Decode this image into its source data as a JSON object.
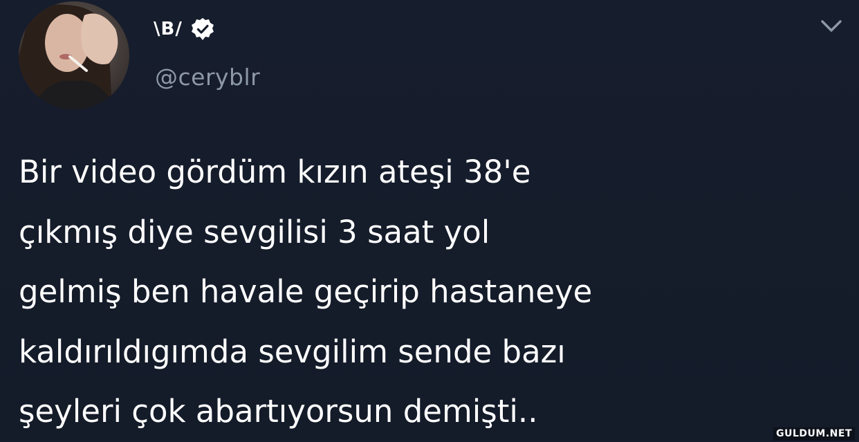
{
  "tweet": {
    "display_name": "\\B/",
    "handle": "@ceryblr",
    "verified": true,
    "text_lines": [
      "Bir video gördüm kızın ateşi 38'e",
      "çıkmış diye sevgilisi 3 saat yol",
      "gelmiş ben havale geçirip hastaneye",
      "kaldırıldıgımda sevgilim sende bazı",
      "şeyleri çok abartıyorsun demişti.."
    ]
  },
  "icons": {
    "verified": "verified-badge-icon",
    "menu": "chevron-down-icon"
  },
  "watermark": "GULDUM.NET",
  "colors": {
    "background": "#151c2b",
    "text": "#ffffff",
    "handle": "#8d98a6",
    "chevron": "#8d98a6"
  }
}
